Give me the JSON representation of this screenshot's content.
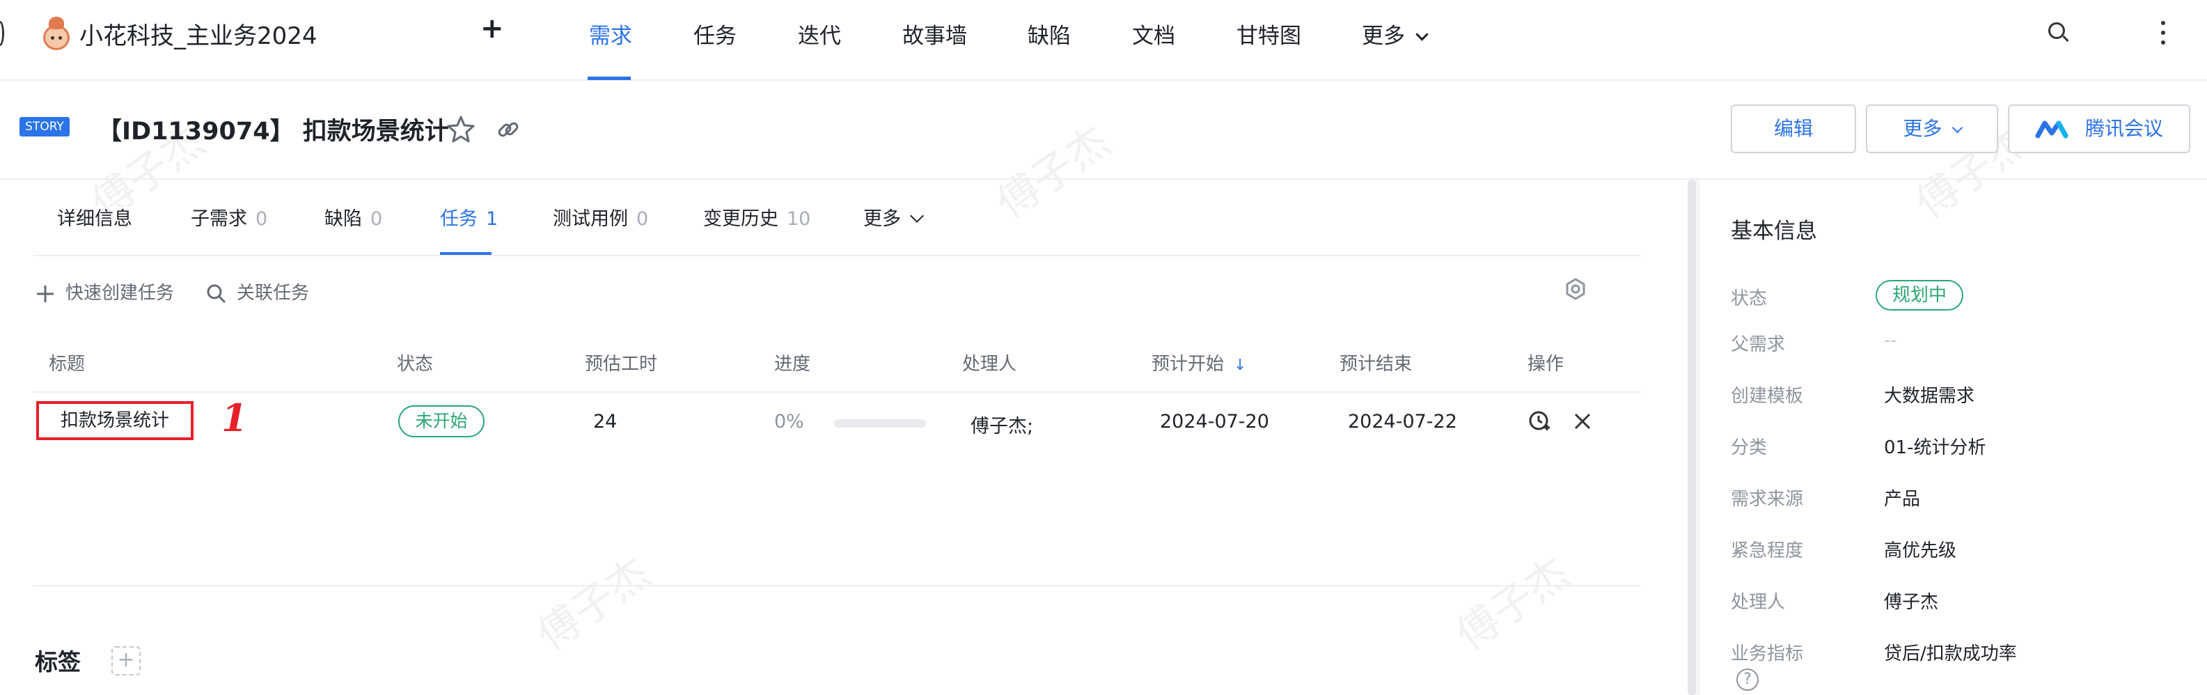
{
  "header": {
    "project_name": "小花科技_主业务2024",
    "plus_label": "+",
    "nav": [
      {
        "label": "需求",
        "active": true
      },
      {
        "label": "任务"
      },
      {
        "label": "迭代"
      },
      {
        "label": "故事墙"
      },
      {
        "label": "缺陷"
      },
      {
        "label": "文档"
      },
      {
        "label": "甘特图"
      },
      {
        "label": "更多"
      }
    ]
  },
  "story": {
    "badge": "STORY",
    "title": "【ID1139074】 扣款场景统计"
  },
  "actions": {
    "edit": "编辑",
    "more": "更多",
    "meeting": "腾讯会议"
  },
  "tabs": [
    {
      "label": "详细信息",
      "count": ""
    },
    {
      "label": "子需求",
      "count": "0"
    },
    {
      "label": "缺陷",
      "count": "0"
    },
    {
      "label": "任务",
      "count": "1",
      "active": true
    },
    {
      "label": "测试用例",
      "count": "0"
    },
    {
      "label": "变更历史",
      "count": "10"
    },
    {
      "label": "更多",
      "count": ""
    }
  ],
  "toolbar": {
    "quick_create": "快速创建任务",
    "link_task": "关联任务"
  },
  "table": {
    "columns": [
      "标题",
      "状态",
      "预估工时",
      "进度",
      "处理人",
      "预计开始",
      "预计结束",
      "操作"
    ],
    "sort_indicator": "↓",
    "rows": [
      {
        "title": "扣款场景统计",
        "status": "未开始",
        "estimate": "24",
        "progress_text": "0%",
        "progress": 0,
        "owner": "傅子杰;",
        "start": "2024-07-20",
        "end": "2024-07-22"
      }
    ]
  },
  "annotation_mark": "1",
  "tags": {
    "title": "标签",
    "add_label": "+"
  },
  "panel": {
    "title": "基本信息",
    "fields": [
      {
        "label": "状态",
        "value": "规划中"
      },
      {
        "label": "父需求",
        "value": "--"
      },
      {
        "label": "创建模板",
        "value": "大数据需求"
      },
      {
        "label": "分类",
        "value": "01-统计分析"
      },
      {
        "label": "需求来源",
        "value": "产品"
      },
      {
        "label": "紧急程度",
        "value": "高优先级"
      },
      {
        "label": "处理人",
        "value": "傅子杰"
      },
      {
        "label": "业务指标",
        "value": "贷后/扣款成功率"
      }
    ],
    "help": "?"
  },
  "watermark": "傅子杰",
  "colors": {
    "accent": "#2b73e8",
    "status_green": "#2aa876",
    "highlight_red": "#e8202a"
  }
}
